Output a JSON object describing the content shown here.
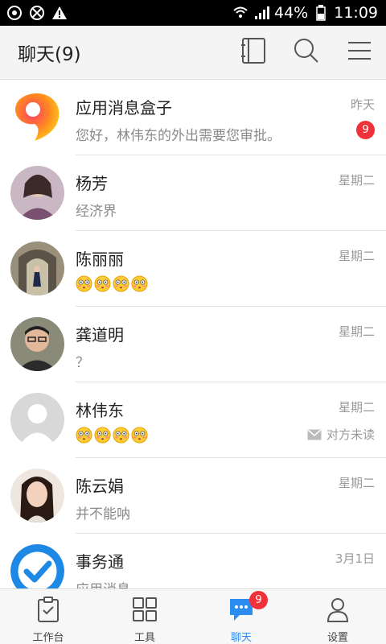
{
  "status_bar": {
    "left_icons": [
      "sync-icon",
      "no-disturb-icon",
      "warning-icon"
    ],
    "battery": "44%",
    "time": "11:09"
  },
  "header": {
    "title": "聊天(9)",
    "actions": [
      "contacts-book-icon",
      "search-icon",
      "menu-icon"
    ]
  },
  "chats": [
    {
      "name": "应用消息盒子",
      "preview": "您好，林伟东的外出需要您审批。",
      "time": "昨天",
      "badge": "9"
    },
    {
      "name": "杨芳",
      "preview": "经济界",
      "time": "星期二"
    },
    {
      "name": "陈丽丽",
      "preview": "",
      "time": "星期二",
      "emoji_count": 4
    },
    {
      "name": "龚道明",
      "preview": "？",
      "time": "星期二"
    },
    {
      "name": "林伟东",
      "preview": "",
      "time": "星期二",
      "emoji_count": 4,
      "read_status": "对方未读"
    },
    {
      "name": "陈云娟",
      "preview": "并不能呐",
      "time": "星期二"
    },
    {
      "name": "事务通",
      "preview": "应用消息",
      "time": "3月1日"
    }
  ],
  "tabs": [
    {
      "label": "工作台",
      "icon": "clipboard-icon"
    },
    {
      "label": "工具",
      "icon": "grid-icon"
    },
    {
      "label": "聊天",
      "icon": "chat-bubble-icon",
      "badge": "9",
      "active": true
    },
    {
      "label": "设置",
      "icon": "person-icon"
    }
  ],
  "colors": {
    "accent": "#2d8cf0",
    "badge": "#f0313a"
  }
}
